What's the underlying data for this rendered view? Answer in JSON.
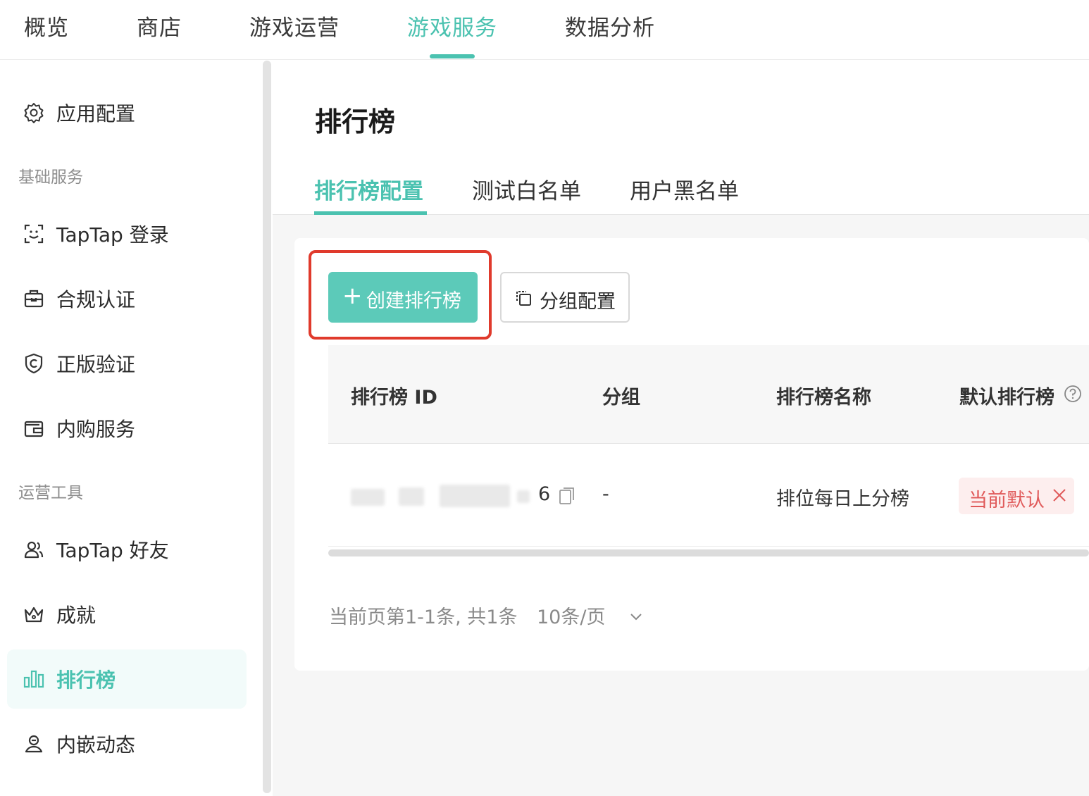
{
  "topnav": {
    "tabs": [
      "概览",
      "商店",
      "游戏运营",
      "游戏服务",
      "数据分析"
    ],
    "active": "游戏服务"
  },
  "sidebar": {
    "top_item": {
      "label": "应用配置",
      "icon": "gear-icon"
    },
    "group1": "基础服务",
    "group1_items": [
      {
        "label": "TapTap 登录",
        "icon": "scan-face-icon"
      },
      {
        "label": "合规认证",
        "icon": "briefcase-icon"
      },
      {
        "label": "正版验证",
        "icon": "shield-c-icon"
      },
      {
        "label": "内购服务",
        "icon": "wallet-icon"
      }
    ],
    "group2": "运营工具",
    "group2_items": [
      {
        "label": "TapTap 好友",
        "icon": "friends-icon"
      },
      {
        "label": "成就",
        "icon": "crown-icon"
      },
      {
        "label": "排行榜",
        "icon": "bar-chart-icon",
        "active": true
      },
      {
        "label": "内嵌动态",
        "icon": "moment-icon"
      }
    ]
  },
  "main": {
    "title": "排行榜",
    "tabs": [
      "排行榜配置",
      "测试白名单",
      "用户黑名单"
    ],
    "active_tab": "排行榜配置",
    "create_button": "创建排行榜",
    "group_button": "分组配置",
    "table": {
      "headers": [
        "排行榜 ID",
        "分组",
        "排行榜名称",
        "默认排行榜"
      ],
      "rows": [
        {
          "id_suffix": "6",
          "group": "-",
          "name": "排位每日上分榜",
          "default_tag": "当前默认"
        }
      ]
    },
    "pagination": {
      "summary": "当前页第1-1条, 共1条",
      "page_size": "10条/页"
    }
  },
  "colors": {
    "accent": "#4bc2b0",
    "button": "#5ccab9",
    "highlight": "#e03a2c",
    "tag_text": "#e05a5a",
    "tag_bg": "#fdeeee"
  }
}
